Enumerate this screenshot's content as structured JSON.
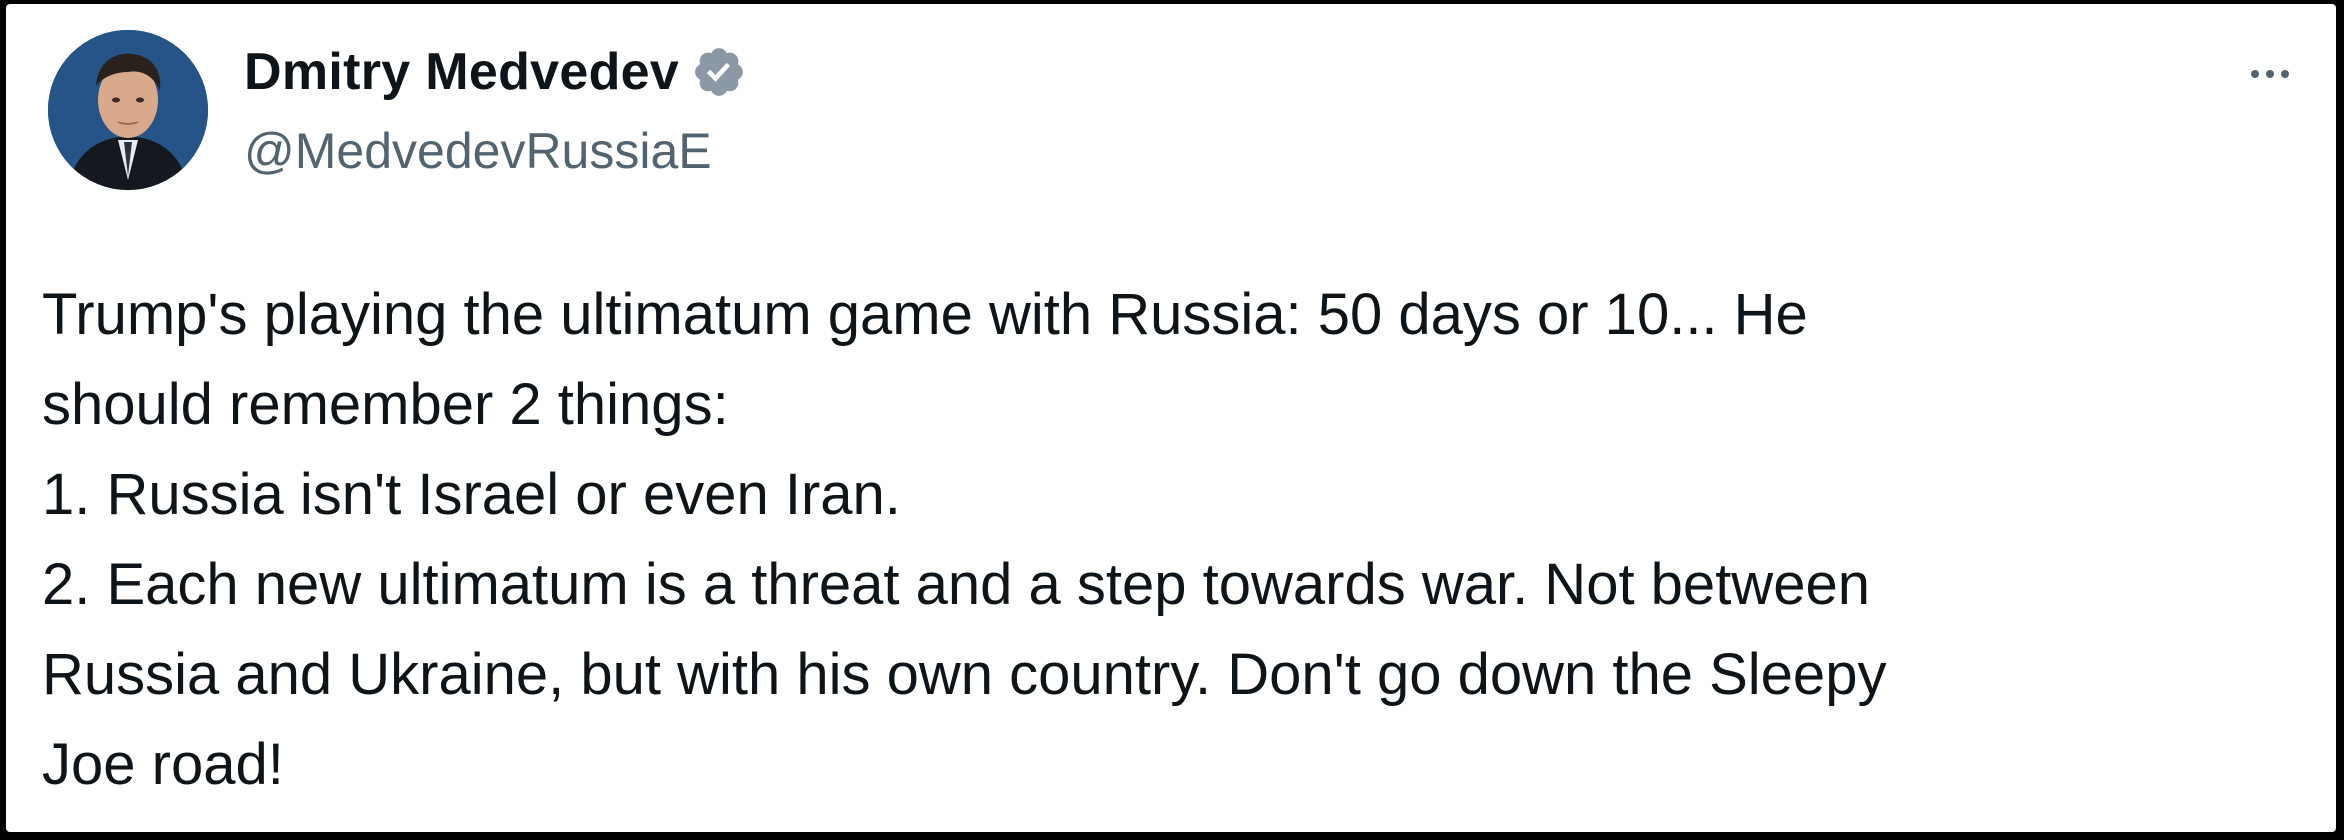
{
  "author": {
    "display_name": "Dmitry Medvedev",
    "handle": "@MedvedevRussiaE",
    "verified": true,
    "verified_icon": "verified-badge-icon",
    "verified_color": "#8b98a5"
  },
  "menu": {
    "icon": "more-options-icon"
  },
  "tweet": {
    "lines": [
      "Trump's playing the ultimatum game with Russia: 50 days or 10... He",
      "should remember 2 things:",
      "1. Russia isn't Israel or even Iran.",
      "2. Each new ultimatum is a threat and a step towards war. Not between",
      "Russia and Ukraine, but with his own country. Don't go down the Sleepy",
      "Joe road!"
    ]
  },
  "colors": {
    "text_primary": "#0f1419",
    "text_secondary": "#536471",
    "background": "#ffffff"
  }
}
